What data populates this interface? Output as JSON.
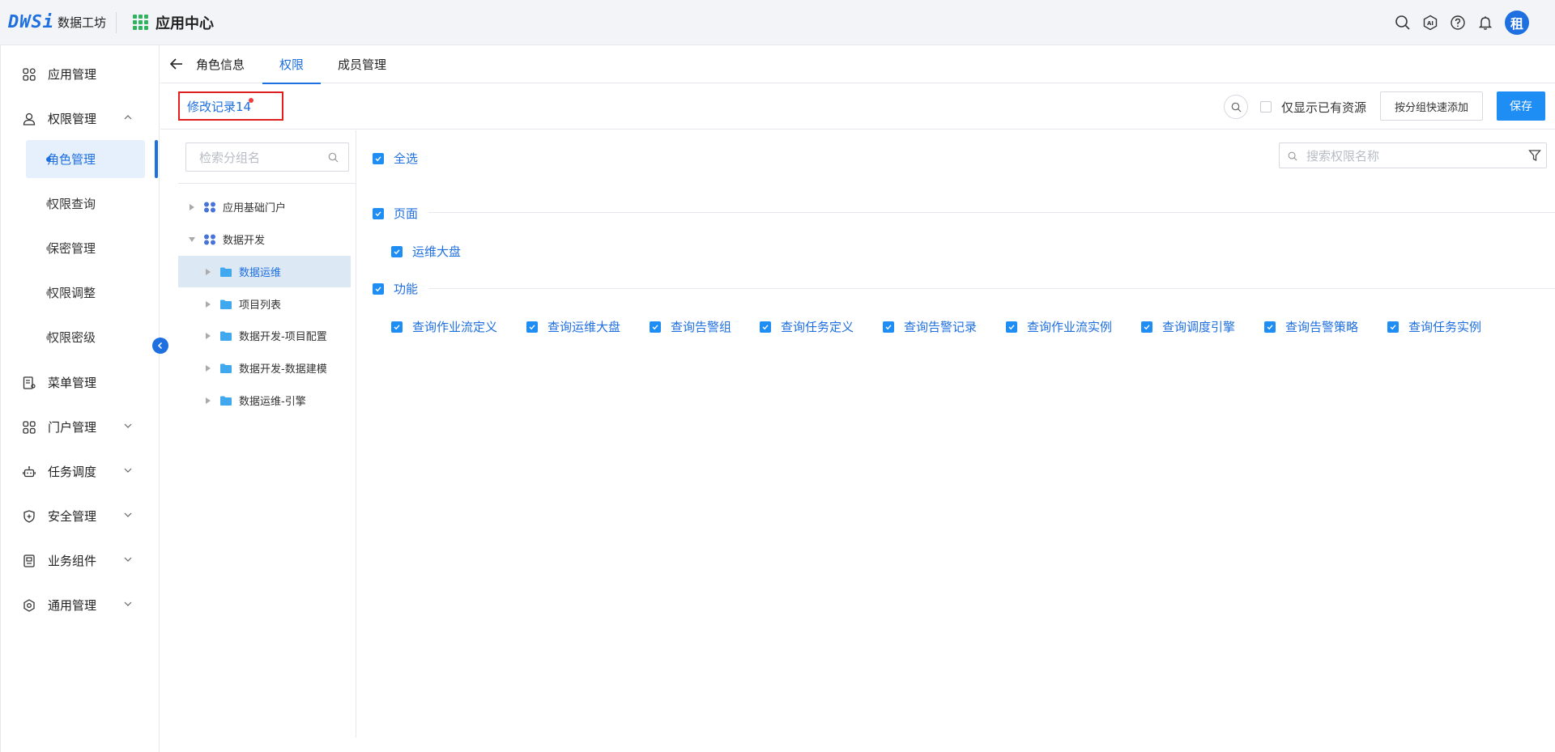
{
  "header": {
    "logo_mark": "DWSi",
    "logo_text": "数据工坊",
    "app_center": "应用中心",
    "avatar": "租",
    "icons": [
      "search-icon",
      "ai-icon",
      "help-icon",
      "bell-icon"
    ]
  },
  "sidebar": {
    "items": [
      {
        "label": "应用管理",
        "icon": "apps-icon"
      },
      {
        "label": "权限管理",
        "icon": "user-lock-icon"
      },
      {
        "label": "菜单管理",
        "icon": "menu-doc-icon"
      },
      {
        "label": "门户管理",
        "icon": "portal-icon"
      },
      {
        "label": "任务调度",
        "icon": "robot-icon"
      },
      {
        "label": "安全管理",
        "icon": "shield-icon"
      },
      {
        "label": "业务组件",
        "icon": "component-icon"
      },
      {
        "label": "通用管理",
        "icon": "settings-icon"
      }
    ],
    "sub_items": [
      {
        "label": "角色管理",
        "active": true
      },
      {
        "label": "权限查询"
      },
      {
        "label": "保密管理"
      },
      {
        "label": "权限调整"
      },
      {
        "label": "权限密级"
      }
    ]
  },
  "tabs": [
    {
      "label": "角色信息"
    },
    {
      "label": "权限",
      "active": true
    },
    {
      "label": "成员管理"
    }
  ],
  "toolbar": {
    "history": "修改记录14",
    "only_existing": "仅显示已有资源",
    "quick_add": "按分组快速添加",
    "save": "保存"
  },
  "tree": {
    "search_placeholder": "检索分组名",
    "nodes": [
      {
        "label": "应用基础门户",
        "level": 0,
        "expanded": false,
        "icon": "group-icon"
      },
      {
        "label": "数据开发",
        "level": 0,
        "expanded": true,
        "icon": "group-icon"
      },
      {
        "label": "数据运维",
        "level": 1,
        "selected": true,
        "icon": "folder-icon"
      },
      {
        "label": "项目列表",
        "level": 1,
        "icon": "folder-icon"
      },
      {
        "label": "数据开发-项目配置",
        "level": 1,
        "icon": "folder-icon"
      },
      {
        "label": "数据开发-数据建模",
        "level": 1,
        "icon": "folder-icon"
      },
      {
        "label": "数据运维-引擎",
        "level": 1,
        "icon": "folder-icon"
      }
    ]
  },
  "permissions": {
    "select_all": "全选",
    "search_placeholder": "搜索权限名称",
    "sections": [
      {
        "title": "页面",
        "items": [
          "运维大盘"
        ]
      },
      {
        "title": "功能",
        "items": [
          "查询作业流定义",
          "查询运维大盘",
          "查询告警组",
          "查询任务定义",
          "查询告警记录",
          "查询作业流实例",
          "查询调度引擎",
          "查询告警策略",
          "查询任务实例"
        ]
      }
    ]
  }
}
